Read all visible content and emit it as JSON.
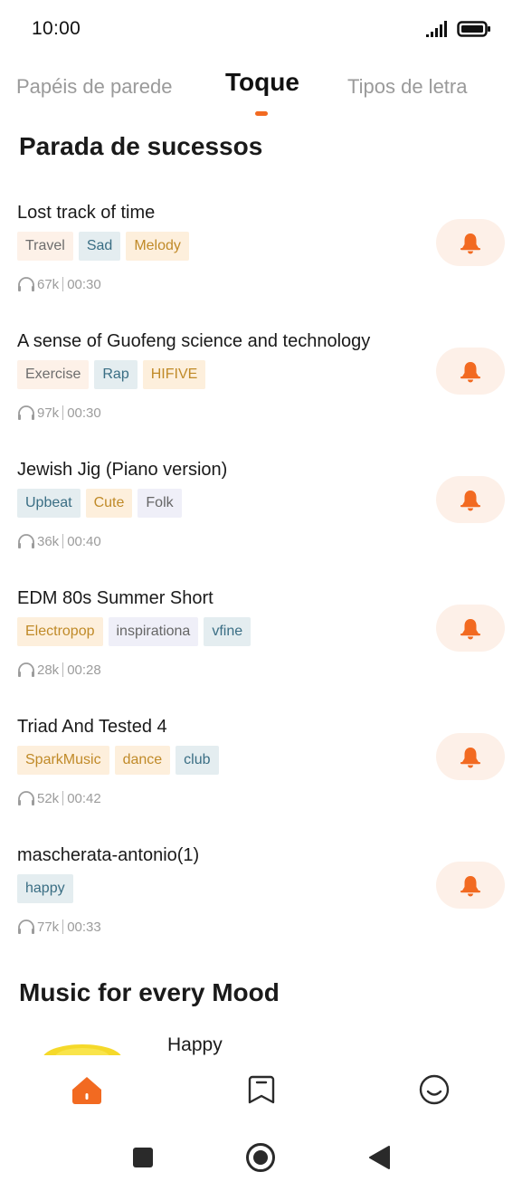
{
  "status": {
    "time": "10:00"
  },
  "tabs": [
    {
      "label": "Papéis de parede"
    },
    {
      "label": "Toque"
    },
    {
      "label": "Tipos de letra"
    }
  ],
  "sections": {
    "hits_title": "Parada de sucessos",
    "mood_title": "Music for every Mood"
  },
  "songs": [
    {
      "title": "Lost track of time",
      "tags": [
        "Travel",
        "Sad",
        "Melody"
      ],
      "plays": "67k",
      "duration": "00:30"
    },
    {
      "title": "A sense of Guofeng science and technology",
      "tags": [
        "Exercise",
        "Rap",
        "HIFIVE"
      ],
      "plays": "97k",
      "duration": "00:30"
    },
    {
      "title": "Jewish Jig (Piano version)",
      "tags": [
        "Upbeat",
        "Cute",
        "Folk"
      ],
      "plays": "36k",
      "duration": "00:40"
    },
    {
      "title": "EDM 80s Summer Short",
      "tags": [
        "Electropop",
        "inspirationa",
        "vfine"
      ],
      "plays": "28k",
      "duration": "00:28"
    },
    {
      "title": "Triad And Tested 4",
      "tags": [
        "SparkMusic",
        "dance",
        "club"
      ],
      "plays": "52k",
      "duration": "00:42"
    },
    {
      "title": "mascherata-antonio(1)",
      "tags": [
        "happy"
      ],
      "plays": "77k",
      "duration": "00:33"
    }
  ],
  "mood": {
    "label": "Happy"
  },
  "colors": {
    "accent": "#f26a21",
    "bell_bg": "#fdf0e8"
  }
}
